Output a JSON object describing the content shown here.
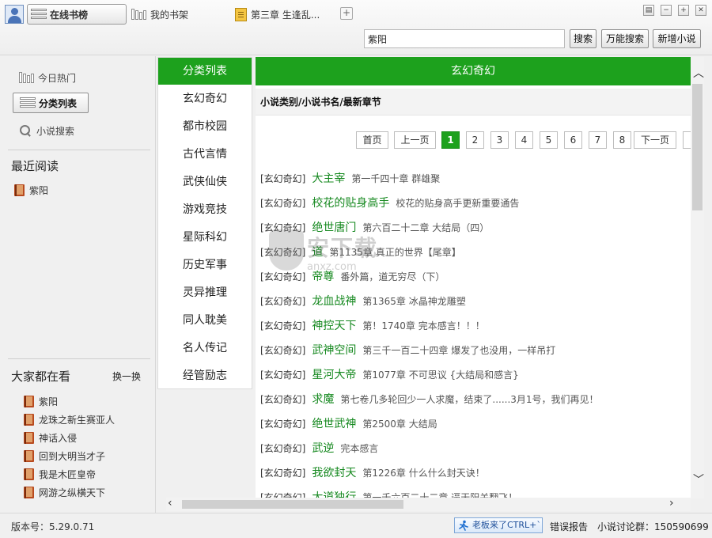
{
  "tabs": {
    "online": "在线书榜",
    "shelf": "我的书架",
    "chapter": "第三章 生逢乱..."
  },
  "search": {
    "value": "紫阳",
    "button": "搜索",
    "all_search": "万能搜索",
    "add_novel": "新增小说"
  },
  "sidebar": {
    "hot": "今日热门",
    "category": "分类列表",
    "novel_search": "小说搜索",
    "recent_title": "最近阅读",
    "recent": [
      "紫阳"
    ],
    "popular_title": "大家都在看",
    "swap": "换一换",
    "popular": [
      "紫阳",
      "龙珠之新生赛亚人",
      "神话入侵",
      "回到大明当才子",
      "我是木匠皇帝",
      "网游之纵横天下"
    ]
  },
  "categories": {
    "header": "分类列表",
    "items": [
      "玄幻奇幻",
      "都市校园",
      "古代言情",
      "武侠仙侠",
      "游戏竞技",
      "星际科幻",
      "历史军事",
      "灵异推理",
      "同人耽美",
      "名人传记",
      "经管励志"
    ]
  },
  "main": {
    "title": "玄幻奇幻",
    "subheader": "小说类别/小说书名/最新章节",
    "pagination": {
      "first": "首页",
      "prev": "上一页",
      "pages": [
        "1",
        "2",
        "3",
        "4",
        "5",
        "6",
        "7",
        "8"
      ],
      "current": "1",
      "next": "下一页"
    },
    "novels": [
      {
        "cat": "[玄幻奇幻]",
        "name": "大主宰",
        "chapter": "第一千四十章 群雄聚"
      },
      {
        "cat": "[玄幻奇幻]",
        "name": "校花的贴身高手",
        "chapter": "校花的贴身高手更新重要通告"
      },
      {
        "cat": "[玄幻奇幻]",
        "name": "绝世唐门",
        "chapter": "第六百二十二章 大结局（四）"
      },
      {
        "cat": "[玄幻奇幻]",
        "name": "道",
        "chapter": "第1135章 真正的世界【尾章】"
      },
      {
        "cat": "[玄幻奇幻]",
        "name": "帝尊",
        "chapter": "番外篇，道无穷尽（下）"
      },
      {
        "cat": "[玄幻奇幻]",
        "name": "龙血战神",
        "chapter": "第1365章 冰晶神龙雕塑"
      },
      {
        "cat": "[玄幻奇幻]",
        "name": "神控天下",
        "chapter": "第！1740章 完本感言！！！"
      },
      {
        "cat": "[玄幻奇幻]",
        "name": "武神空间",
        "chapter": "第三千一百二十四章 爆发了也没用，一样吊打"
      },
      {
        "cat": "[玄幻奇幻]",
        "name": "星河大帝",
        "chapter": "第1077章 不可思议 {大结局和感言}"
      },
      {
        "cat": "[玄幻奇幻]",
        "name": "求魔",
        "chapter": "第七卷几多轮回少一人求魔，结束了......3月1号，我们再见！"
      },
      {
        "cat": "[玄幻奇幻]",
        "name": "绝世武神",
        "chapter": "第2500章 大结局"
      },
      {
        "cat": "[玄幻奇幻]",
        "name": "武逆",
        "chapter": "完本感言"
      },
      {
        "cat": "[玄幻奇幻]",
        "name": "我欲封天",
        "chapter": "第1226章 什么什么封天诀！"
      },
      {
        "cat": "[玄幻奇幻]",
        "name": "大道独行",
        "chapter": "第一千六百二十二章 逼天阳关翻飞！"
      }
    ]
  },
  "watermark": {
    "text": "安下载",
    "domain": "anxz.com"
  },
  "status": {
    "version": "版本号：5.29.0.71",
    "boss": "老板来了CTRL+`",
    "report": "错误报告",
    "qq_group": "小说讨论群：150590699"
  },
  "colors": {
    "accent_green": "#1da11d",
    "link_green": "#14881e"
  }
}
